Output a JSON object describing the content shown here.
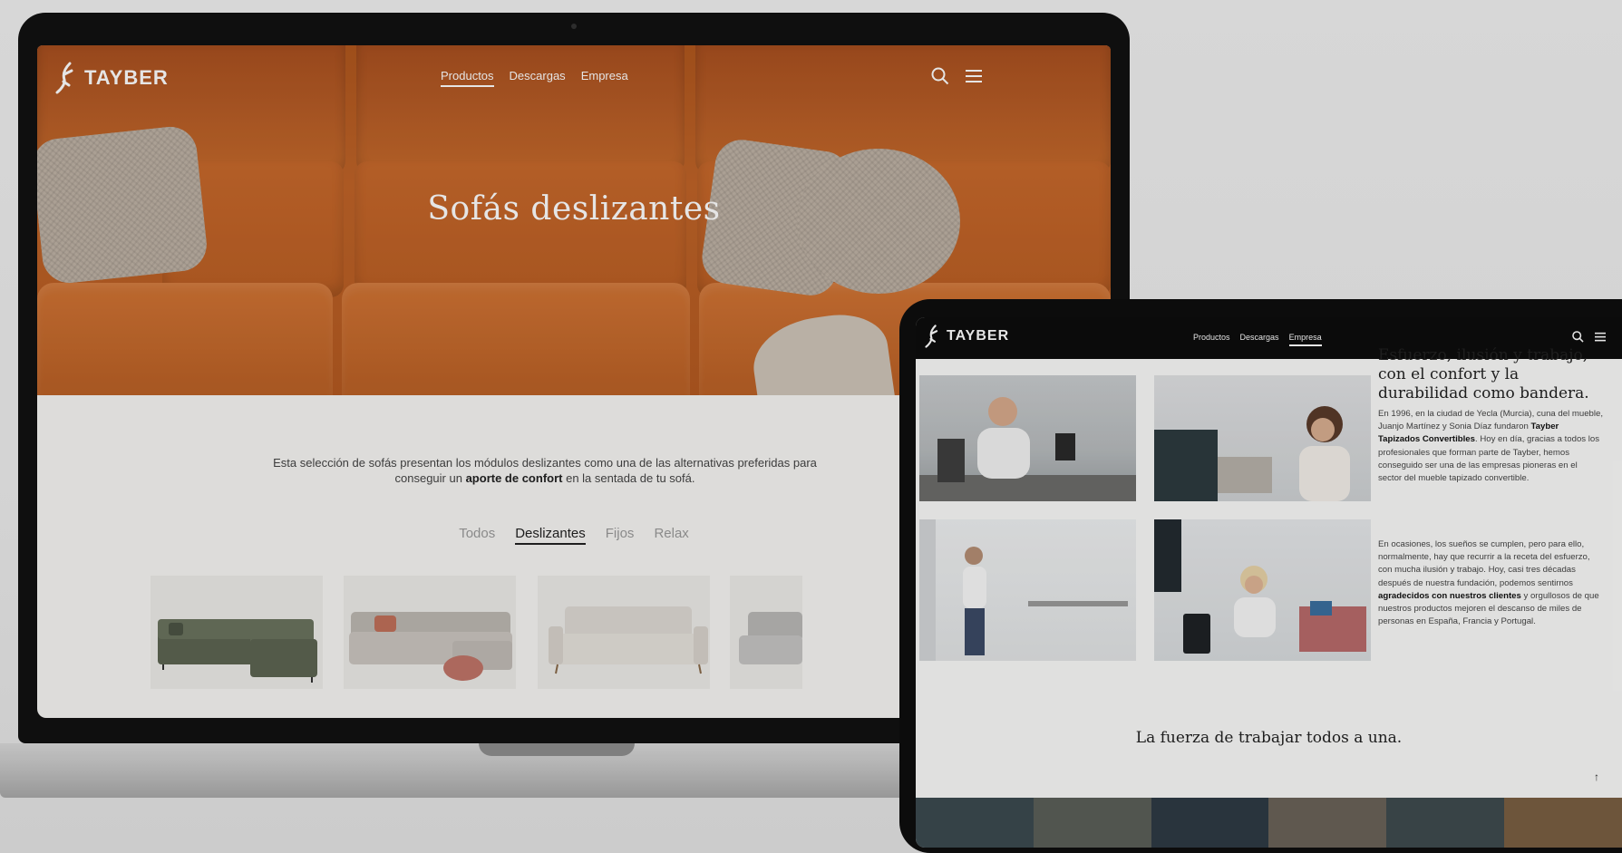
{
  "colors": {
    "accent_orange": "#c06428",
    "nav_dark": "#0d0d0d",
    "text_dark": "#222222"
  },
  "laptop": {
    "logo_text": "TAYBER",
    "nav": [
      "Productos",
      "Descargas",
      "Empresa"
    ],
    "nav_active": "Productos",
    "hero_title": "Sofás deslizantes",
    "intro": {
      "part1": "Esta selección de sofás presentan los módulos deslizantes como una de las alternativas preferidas para conseguir un ",
      "bold": "aporte de confort",
      "part2": " en la sentada de tu sofá."
    },
    "filters": [
      "Todos",
      "Deslizantes",
      "Fijos",
      "Relax"
    ],
    "filter_active": "Deslizantes",
    "icons": [
      "search-icon",
      "menu-icon"
    ]
  },
  "tablet": {
    "logo_text": "TAYBER",
    "nav": [
      "Productos",
      "Descargas",
      "Empresa"
    ],
    "nav_active": "Empresa",
    "heading": "Esfuerzo, ilusión y trabajo, con el confort y la durabilidad como bandera.",
    "para1": {
      "part1": "En 1996, en la ciudad de Yecla (Murcia), cuna del mueble, Juanjo Martínez y Sonia Díaz fundaron ",
      "bold": "Tayber Tapizados Convertibles",
      "part2": ". Hoy en día, gracias a todos los profesionales que forman parte de Tayber, hemos conseguido ser una de las empresas pioneras en el sector del mueble tapizado convertible."
    },
    "para2": {
      "part1": "En ocasiones, los sueños se cumplen, pero para ello, normalmente, hay que recurrir a la receta del esfuerzo, con mucha ilusión y trabajo. Hoy, casi tres décadas después de nuestra fundación, podemos sentirnos ",
      "bold": "agradecidos con nuestros clientes",
      "part2": " y orgullosos de que nuestros productos mejoren el descanso de miles de personas en España, Francia y Portugal."
    },
    "quote": "La fuerza de trabajar todos a una.",
    "scroll_up": "↑",
    "icons": [
      "search-icon",
      "menu-icon"
    ]
  }
}
